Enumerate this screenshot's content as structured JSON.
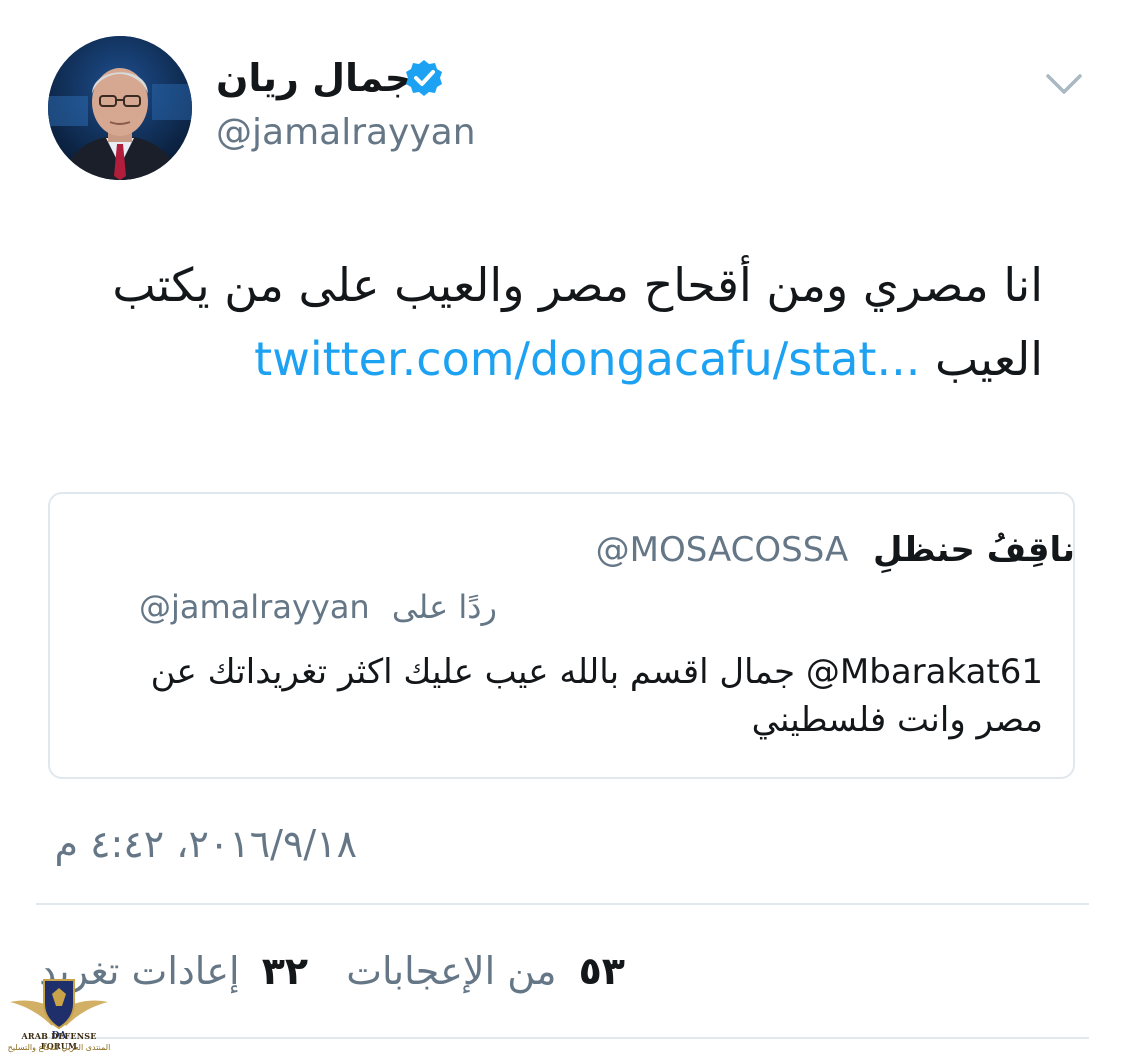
{
  "tweet": {
    "author": {
      "display_name": "جمال ريان",
      "handle": "@jamalrayyan",
      "verified": true,
      "avatar_icon": "profile-photo"
    },
    "text": "انا مصري ومن أقحاح مصر والعيب على من يكتب العيب",
    "link": "twitter.com/dongacafu/stat...",
    "timestamp": "٢٠١٦/٩/١٨، ٤:٤٢ م",
    "stats": {
      "retweets_count": "٣٢",
      "retweets_label": "إعادات تغريد",
      "likes_count": "٥٣",
      "likes_label": "من الإعجابات"
    }
  },
  "quoted_tweet": {
    "display_name": "ناقِفُ حنظلِ",
    "handle": "@MOSACOSSA",
    "reply_prefix": "ردًا على",
    "reply_to": "@jamalrayyan",
    "mention": "@Mbarakat61",
    "text": "جمال اقسم بالله عيب عليك اكثر تغريداتك عن مصر وانت فلسطيني"
  },
  "watermark": {
    "title": "ARAB DEFENSE FORUM",
    "subtitle": "المنتدى العربي للدفاع والتسليح",
    "logo_icon": "winged-shield-logo"
  },
  "colors": {
    "link": "#1da1f2",
    "verified": "#1da1f2",
    "secondary_text": "#657786",
    "divider": "#e1e8ed"
  }
}
